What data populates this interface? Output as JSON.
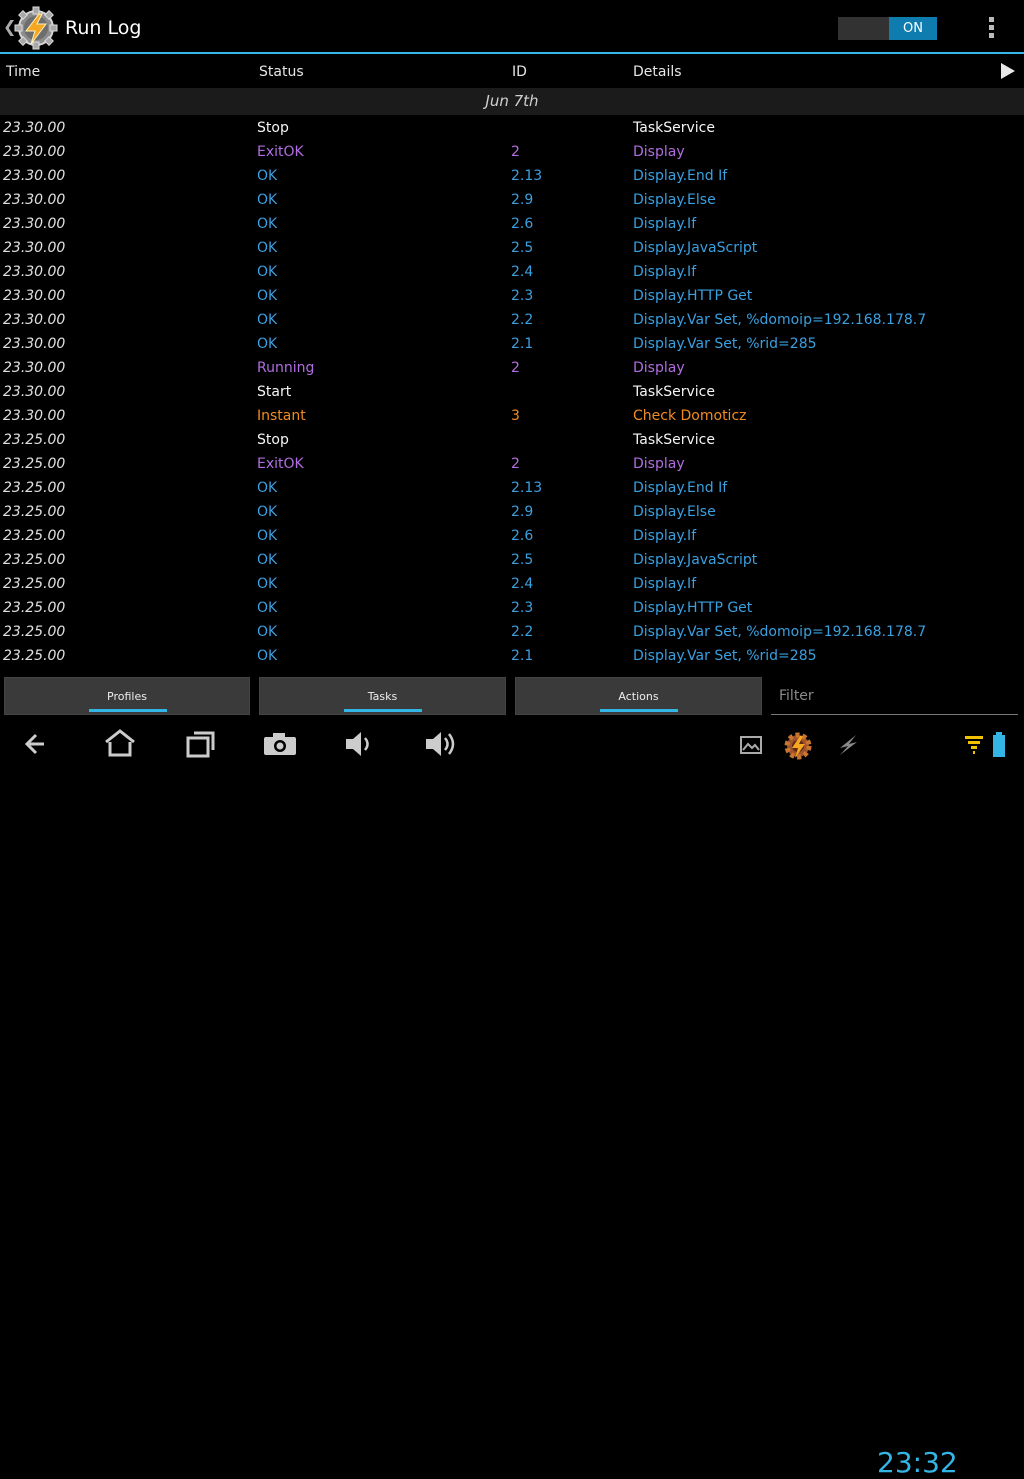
{
  "header": {
    "title": "Run Log",
    "toggle_label": "ON"
  },
  "columns": {
    "time": "Time",
    "status": "Status",
    "id": "ID",
    "details": "Details"
  },
  "date_label": "Jun 7th",
  "log": [
    {
      "time": "23.30.00",
      "status": "Stop",
      "id": "",
      "details": "TaskService",
      "kind": "white"
    },
    {
      "time": "23.30.00",
      "status": "ExitOK",
      "id": "2",
      "details": "Display",
      "kind": "purple"
    },
    {
      "time": "23.30.00",
      "status": "OK",
      "id": "2.13",
      "details": "Display.End If",
      "kind": "blue"
    },
    {
      "time": "23.30.00",
      "status": "OK",
      "id": "2.9",
      "details": "Display.Else",
      "kind": "blue"
    },
    {
      "time": "23.30.00",
      "status": "OK",
      "id": "2.6",
      "details": "Display.If",
      "kind": "blue"
    },
    {
      "time": "23.30.00",
      "status": "OK",
      "id": "2.5",
      "details": "Display.JavaScript",
      "kind": "blue"
    },
    {
      "time": "23.30.00",
      "status": "OK",
      "id": "2.4",
      "details": "Display.If",
      "kind": "blue"
    },
    {
      "time": "23.30.00",
      "status": "OK",
      "id": "2.3",
      "details": "Display.HTTP Get",
      "kind": "blue"
    },
    {
      "time": "23.30.00",
      "status": "OK",
      "id": "2.2",
      "details": "Display.Var Set, %domoip=192.168.178.7",
      "kind": "blue"
    },
    {
      "time": "23.30.00",
      "status": "OK",
      "id": "2.1",
      "details": "Display.Var Set, %rid=285",
      "kind": "blue"
    },
    {
      "time": "23.30.00",
      "status": "Running",
      "id": "2",
      "details": "Display",
      "kind": "purple"
    },
    {
      "time": "23.30.00",
      "status": "Start",
      "id": "",
      "details": "TaskService",
      "kind": "white"
    },
    {
      "time": "23.30.00",
      "status": "Instant",
      "id": "3",
      "details": "Check Domoticz",
      "kind": "orange"
    },
    {
      "time": "23.25.00",
      "status": "Stop",
      "id": "",
      "details": "TaskService",
      "kind": "white"
    },
    {
      "time": "23.25.00",
      "status": "ExitOK",
      "id": "2",
      "details": "Display",
      "kind": "purple"
    },
    {
      "time": "23.25.00",
      "status": "OK",
      "id": "2.13",
      "details": "Display.End If",
      "kind": "blue"
    },
    {
      "time": "23.25.00",
      "status": "OK",
      "id": "2.9",
      "details": "Display.Else",
      "kind": "blue"
    },
    {
      "time": "23.25.00",
      "status": "OK",
      "id": "2.6",
      "details": "Display.If",
      "kind": "blue"
    },
    {
      "time": "23.25.00",
      "status": "OK",
      "id": "2.5",
      "details": "Display.JavaScript",
      "kind": "blue"
    },
    {
      "time": "23.25.00",
      "status": "OK",
      "id": "2.4",
      "details": "Display.If",
      "kind": "blue"
    },
    {
      "time": "23.25.00",
      "status": "OK",
      "id": "2.3",
      "details": "Display.HTTP Get",
      "kind": "blue"
    },
    {
      "time": "23.25.00",
      "status": "OK",
      "id": "2.2",
      "details": "Display.Var Set, %domoip=192.168.178.7",
      "kind": "blue"
    },
    {
      "time": "23.25.00",
      "status": "OK",
      "id": "2.1",
      "details": "Display.Var Set, %rid=285",
      "kind": "blue"
    }
  ],
  "tabs": {
    "profiles": "Profiles",
    "tasks": "Tasks",
    "actions": "Actions"
  },
  "filter": {
    "placeholder": "Filter"
  },
  "clock": "23:32",
  "colors": {
    "accent": "#33b5e5",
    "white": "#f5f5f5",
    "purple": "#b06ee0",
    "blue": "#3aa0e0",
    "orange": "#f08c22"
  },
  "icons": {
    "app": "tasker-gear-bolt-icon",
    "system": [
      "back-icon",
      "home-icon",
      "recent-apps-icon",
      "camera-icon",
      "volume-down-icon",
      "volume-up-icon",
      "gallery-notification-icon",
      "tasker-notification-icon",
      "usb-notification-icon",
      "wifi-icon",
      "battery-icon"
    ]
  }
}
